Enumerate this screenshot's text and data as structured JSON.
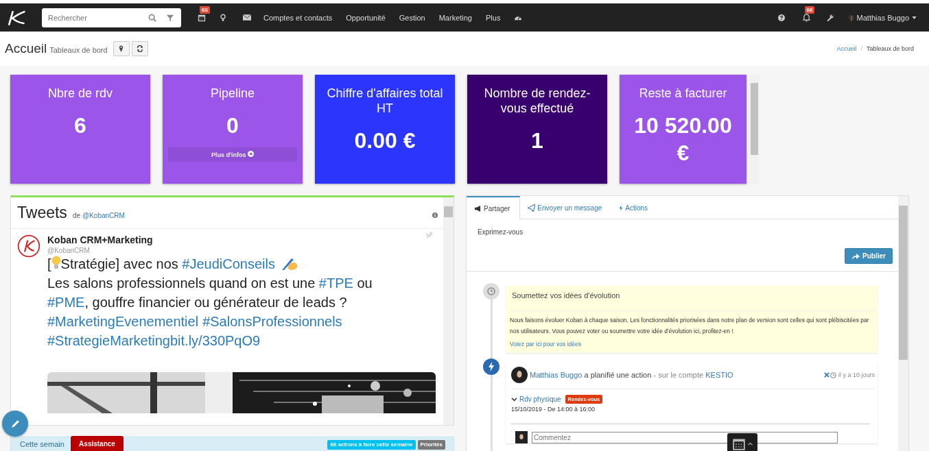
{
  "header": {
    "search": {
      "placeholder": "Rechercher"
    },
    "calendar_badge": "66",
    "menu": [
      "Comptes et contacts",
      "Opportunité",
      "Gestion",
      "Marketing",
      "Plus"
    ],
    "notification_badge": "66",
    "user": "Matthias Buggo"
  },
  "page": {
    "title": "Accueil",
    "subtitle": "Tableaux de bord",
    "breadcrumb": [
      {
        "label": "Accueil",
        "link": true
      },
      {
        "label": "Tableaux de bord",
        "link": false
      }
    ],
    "breadcrumb_separator": "/"
  },
  "tiles": [
    {
      "title": "Nbre de rdv",
      "value": "6",
      "color": "#9b55e8"
    },
    {
      "title": "Pipeline",
      "value": "0",
      "color": "#9b55e8",
      "link": "Plus d'infos"
    },
    {
      "title": "Chiffre d'affaires total HT",
      "value": "0.00 €",
      "color": "#2b35fc"
    },
    {
      "title": "Nombre de rendez-vous effectué",
      "value": "1",
      "color": "#38006e"
    },
    {
      "title": "Reste à facturer",
      "value": "10 520.00 €",
      "color": "#9b55e8"
    }
  ],
  "tweets": {
    "title": "Tweets",
    "by": "de",
    "handle_link": "@KobanCRM",
    "tweet": {
      "author": "Koban CRM+Marketing",
      "handle": "@KobanCRM",
      "lines": [
        [
          {
            "kind": "text",
            "text": "["
          },
          {
            "kind": "bulb"
          },
          {
            "kind": "text",
            "text": "Stratégie] avec nos "
          },
          {
            "kind": "tag",
            "text": "#JeudiConseils"
          },
          {
            "kind": "hand"
          }
        ],
        [
          {
            "kind": "text",
            "text": "Les salons professionnels quand on est une "
          },
          {
            "kind": "tag",
            "text": "#TPE"
          },
          {
            "kind": "text",
            "text": " ou"
          }
        ],
        [
          {
            "kind": "tag",
            "text": "#PME"
          },
          {
            "kind": "text",
            "text": ", gouffre financier ou générateur de leads ?"
          }
        ],
        [
          {
            "kind": "tag",
            "text": "#MarketingEvenementiel"
          },
          {
            "kind": "tag",
            "text": "#SalonsProfessionnels"
          }
        ],
        [
          {
            "kind": "tag",
            "text": "#StrategieMarketingbit.ly/330PqO9"
          }
        ]
      ]
    }
  },
  "week_bar": {
    "label": "Cette semain",
    "badges": [
      {
        "text": "66 actions à faire cette semaine",
        "color": "#00c0ef"
      },
      {
        "text": "Priorités",
        "color": "#777777"
      }
    ]
  },
  "assistance": "Assistance",
  "feed": {
    "tabs": [
      {
        "label": "Partager",
        "selected": true
      },
      {
        "label": "Envoyer un message",
        "selected": false
      },
      {
        "label": "Actions",
        "selected": false
      }
    ],
    "placeholder": "Exprimez-vous",
    "publish": "Publier",
    "idea": {
      "title": "Soumettez vos idées d'évolution",
      "text": "Nous faisons évoluer Koban à chaque saison. Les fonctionnalités priorisées dans notre plan de version sont celles qui sont plébiscitées par nos utilisateurs. Vous pouvez voter ou soumettre votre idée d'évolution ici, profitez-en !",
      "link": "Votez par ici pour vos idées"
    },
    "action": {
      "user": "Matthias Buggo",
      "verb": " a planifié une action",
      "on": " - sur le compte ",
      "account": "KESTIO",
      "time": "il y a 10 jours",
      "type": "Rdv physique",
      "tag": "Rendez-vous",
      "when": "15/10/2019 - De 14:00 à 16:00",
      "comment_placeholder": "Commentez"
    }
  }
}
